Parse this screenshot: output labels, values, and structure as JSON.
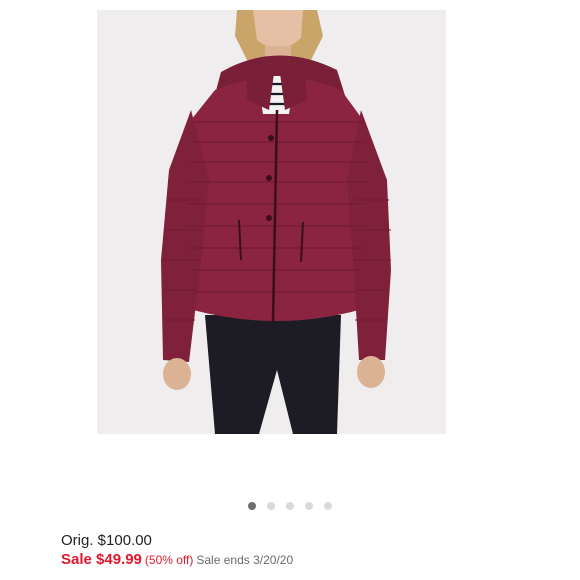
{
  "product": {
    "image_alt": "Women's packable puffer jacket in berry red with hood, worn over striped top and dark jeans",
    "jacket_color": "#8b2440",
    "background_color": "#efeded"
  },
  "carousel": {
    "count": 5,
    "active_index": 0
  },
  "pricing": {
    "orig": "Orig. $100.00",
    "sale_price": "Sale $49.99",
    "discount": "(50% off)",
    "sale_ends": "Sale ends 3/20/20",
    "sale_color": "#e0182d"
  }
}
